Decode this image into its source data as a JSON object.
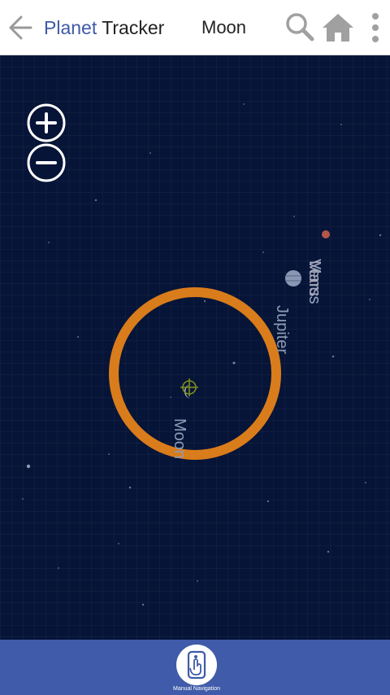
{
  "header": {
    "title_part1": "Planet",
    "title_part2": "Tracker",
    "selected_object": "Moon",
    "icons": [
      "arrow-left-icon",
      "search-icon",
      "home-icon",
      "more-vertical-icon"
    ]
  },
  "sky": {
    "labels": {
      "venus": "Venus",
      "mars": "Mars",
      "jupiter": "Jupiter",
      "moon": "Moon"
    }
  },
  "zoom": {
    "icons": [
      "plus-circle-icon",
      "minus-circle-icon"
    ]
  },
  "bottom": {
    "manual_label": "Manual Navigation",
    "icon": "touch-hand-icon"
  },
  "colors": {
    "title_accent": "#3f5aa8",
    "sky_background": "#061437",
    "target_ring": "#d97c1b",
    "bottom_bar": "#3f5ba9"
  }
}
